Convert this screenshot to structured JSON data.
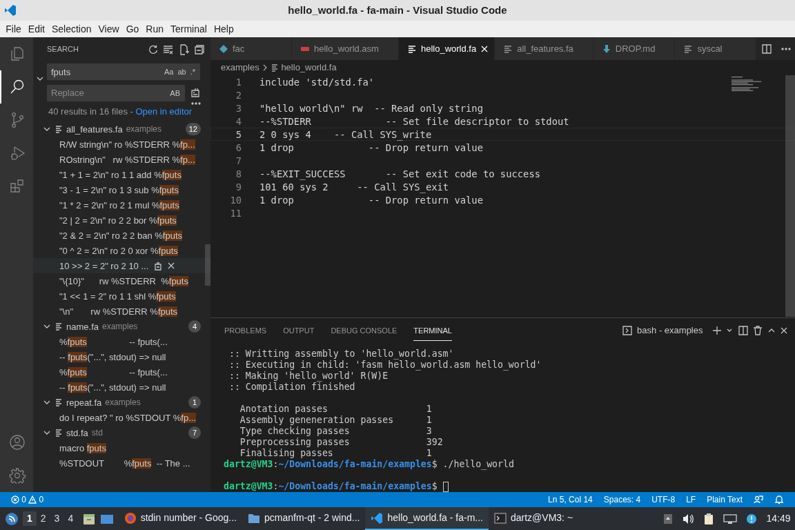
{
  "window": {
    "title": "hello_world.fa - fa-main - Visual Studio Code"
  },
  "menu": [
    "File",
    "Edit",
    "Selection",
    "View",
    "Go",
    "Run",
    "Terminal",
    "Help"
  ],
  "activity_bar": [
    {
      "kind": "explorer",
      "selected": false
    },
    {
      "kind": "search",
      "selected": true
    },
    {
      "kind": "scm",
      "selected": false
    },
    {
      "kind": "debug",
      "selected": false
    },
    {
      "kind": "extensions",
      "selected": false
    }
  ],
  "sidebar": {
    "title": "SEARCH",
    "search": {
      "value": "fputs",
      "toggles": [
        "Aa",
        "ab",
        ".*"
      ]
    },
    "replace": {
      "placeholder": "Replace",
      "toggle": "AB"
    },
    "summary": "40 results in 16 files - ",
    "summary_link": "Open in editor",
    "files": [
      {
        "name": "all_features.fa",
        "folder": "examples",
        "count": "12",
        "expanded": true,
        "matches": [
          {
            "before": "R/W string\\n\" ro %STDERR %",
            "match": "fp...",
            "hovered": false
          },
          {
            "before": "ROstring\\n\"   rw %STDERR %",
            "match": "fp...",
            "hovered": false
          },
          {
            "before": "\"1 + 1 = 2\\n\" ro 1 1 add %",
            "match": "fputs",
            "hovered": false
          },
          {
            "before": "\"3 - 1 = 2\\n\" ro 1 3 sub %",
            "match": "fputs",
            "hovered": false
          },
          {
            "before": "\"1 * 2 = 2\\n\" ro 2 1 mul %",
            "match": "fputs",
            "hovered": false
          },
          {
            "before": "\"2 | 2 = 2\\n\" ro 2 2 bor %",
            "match": "fputs",
            "hovered": false
          },
          {
            "before": "\"2 & 2 = 2\\n\" ro 2 2 ban %",
            "match": "fputs",
            "hovered": false
          },
          {
            "before": "\"0 ^ 2 = 2\\n\" ro 2 0 xor %",
            "match": "fputs",
            "hovered": false
          },
          {
            "before": "10 >> 2 = 2\" ro 2 10 ...",
            "hovered": true
          },
          {
            "before": "\"\\{10}\"      rw %STDERR  %",
            "match": "fputs",
            "hovered": false
          },
          {
            "before": "\"1 << 1 = 2\" ro 1 1 shl %",
            "match": "fputs",
            "hovered": false
          },
          {
            "before": "\"\\n\"       rw %STDERR %",
            "match": "fputs",
            "hovered": false
          }
        ]
      },
      {
        "name": "name.fa",
        "folder": "examples",
        "count": "4",
        "expanded": true,
        "matches": [
          {
            "before": "%",
            "match": "fputs",
            "after": "                 -- fputs(...",
            "hovered": false
          },
          {
            "before": "-- ",
            "match": "fputs",
            "after": "(\"...\", stdout) => null",
            "hovered": false
          },
          {
            "before": "%",
            "match": "fputs",
            "after": "                 -- fputs(...",
            "hovered": false
          },
          {
            "before": "-- ",
            "match": "fputs",
            "after": "(\"...\", stdout) => null",
            "hovered": false
          }
        ]
      },
      {
        "name": "repeat.fa",
        "folder": "examples",
        "count": "1",
        "expanded": true,
        "matches": [
          {
            "before": "do I repeat? \" ro %STDOUT %",
            "match": "fp...",
            "hovered": false
          }
        ]
      },
      {
        "name": "std.fa",
        "folder": "std",
        "count": "7",
        "expanded": true,
        "matches": [
          {
            "before": "macro ",
            "match": "fputs",
            "hovered": false
          },
          {
            "before": "%STDOUT        %",
            "match": "fputs",
            "after": "  -- The ...",
            "hovered": false
          }
        ]
      }
    ]
  },
  "tabs": [
    {
      "label": "fac",
      "kind": "diamond",
      "selected": false
    },
    {
      "label": "hello_world.asm",
      "kind": "asm",
      "selected": false
    },
    {
      "label": "hello_world.fa",
      "kind": "lines",
      "selected": true
    },
    {
      "label": "all_features.fa",
      "kind": "lines",
      "selected": false
    },
    {
      "label": "DROP.md",
      "kind": "download",
      "selected": false
    },
    {
      "label": "syscal",
      "kind": "lines",
      "selected": false
    }
  ],
  "breadcrumb": [
    "examples",
    "hello_world.fa"
  ],
  "code": [
    {
      "number": "1",
      "text": "include 'std/std.fa'",
      "current": false
    },
    {
      "number": "2",
      "current": false
    },
    {
      "number": "3",
      "text": "\"hello world\\n\" rw  -- Read only string",
      "current": false
    },
    {
      "number": "4",
      "text": "--%STDERR             -- Set file descriptor to stdout",
      "current": false
    },
    {
      "number": "5",
      "text": "2 0 sys 4    -- Call SYS_write",
      "current": true
    },
    {
      "number": "6",
      "text": "1 drop             -- Drop return value",
      "current": false
    },
    {
      "number": "7",
      "current": false
    },
    {
      "number": "8",
      "text": "--%EXIT_SUCCESS       -- Set exit code to success",
      "current": false
    },
    {
      "number": "9",
      "text": "101 60 sys 2     -- Call SYS_exit",
      "current": false
    },
    {
      "number": "10",
      "text": "1 drop             -- Drop return value",
      "current": false
    },
    {
      "number": "11",
      "current": false
    }
  ],
  "panel": {
    "tabs": [
      {
        "label": "PROBLEMS",
        "selected": false
      },
      {
        "label": "OUTPUT",
        "selected": false
      },
      {
        "label": "DEBUG CONSOLE",
        "selected": false
      },
      {
        "label": "TERMINAL",
        "selected": true
      }
    ],
    "terminal_name": "bash - examples",
    "lines": [
      {
        "kind": "text",
        "text": " :: Writting assembly to 'hello_world.asm'"
      },
      {
        "kind": "text",
        "text": " :: Executing in child: 'fasm hello_world.asm hello_world'"
      },
      {
        "kind": "text",
        "text": " :: Making 'hello_world' R(W)E"
      },
      {
        "kind": "text",
        "text": " :: Compilation finished"
      },
      {
        "kind": "blank"
      },
      {
        "kind": "text",
        "text": "   Anotation passes                  1"
      },
      {
        "kind": "text",
        "text": "   Assembly geneneration passes      1"
      },
      {
        "kind": "text",
        "text": "   Type checking passes              3"
      },
      {
        "kind": "text",
        "text": "   Preprocessing passes              392"
      },
      {
        "kind": "text",
        "text": "   Finalising passes                 1"
      },
      {
        "kind": "prompt",
        "user": "dartz@VM3",
        "sep": ":",
        "path": "~/Downloads/fa-main/examples",
        "command": "$ ./hello_world",
        "cursor": false
      },
      {
        "kind": "blank"
      },
      {
        "kind": "prompt",
        "user": "dartz@VM3",
        "sep": ":",
        "path": "~/Downloads/fa-main/examples",
        "command": "$ ",
        "cursor": true
      }
    ]
  },
  "status_bar": {
    "errors": "0",
    "warnings": "0",
    "items": [
      "Ln 5, Col 14",
      "Spaces: 4",
      "UTF-8",
      "LF",
      "Plain Text"
    ]
  },
  "taskbar": {
    "workspaces": [
      {
        "label": "1",
        "selected": true
      },
      {
        "label": "2",
        "selected": false
      },
      {
        "label": "3",
        "selected": false
      },
      {
        "label": "4",
        "selected": false
      }
    ],
    "tasks": [
      {
        "label": "stdin number - Goog...",
        "kind": "browser",
        "selected": false
      },
      {
        "label": "pcmanfm-qt - 2 wind...",
        "kind": "folder",
        "selected": false
      },
      {
        "label": "hello_world.fa - fa-m...",
        "kind": "code",
        "selected": true
      },
      {
        "label": "dartz@VM3: ~",
        "kind": "terminal",
        "selected": false
      }
    ],
    "clock": "14:49"
  }
}
